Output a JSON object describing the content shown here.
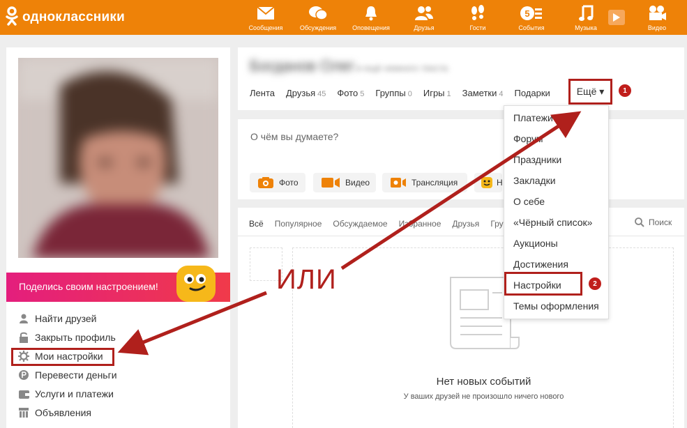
{
  "brand": {
    "name": "одноклассники"
  },
  "topnav": {
    "items": [
      {
        "label": "Сообщения",
        "icon": "envelope-icon"
      },
      {
        "label": "Обсуждения",
        "icon": "chat-bubbles-icon"
      },
      {
        "label": "Оповещения",
        "icon": "bell-icon"
      },
      {
        "label": "Друзья",
        "icon": "friends-icon"
      },
      {
        "label": "Гости",
        "icon": "footprints-icon"
      },
      {
        "label": "События",
        "icon": "events-icon",
        "badge": "5"
      },
      {
        "label": "Музыка",
        "icon": "music-note-icon"
      },
      {
        "label": "Видео",
        "icon": "video-camera-icon"
      }
    ]
  },
  "mood_banner": {
    "text": "Поделись своим настроением!"
  },
  "left_menu": {
    "items": [
      {
        "label": "Найти друзей",
        "icon": "person-icon"
      },
      {
        "label": "Закрыть профиль",
        "icon": "lock-icon"
      },
      {
        "label": "Мои настройки",
        "icon": "gear-icon"
      },
      {
        "label": "Перевести деньги",
        "icon": "coin-icon"
      },
      {
        "label": "Услуги и платежи",
        "icon": "wallet-icon"
      },
      {
        "label": "Объявления",
        "icon": "ads-icon"
      }
    ]
  },
  "profile": {
    "name": "Богданов Олег",
    "subtitle": "и ещё немного текста",
    "tabs": [
      {
        "label": "Лента",
        "count": ""
      },
      {
        "label": "Друзья",
        "count": "45"
      },
      {
        "label": "Фото",
        "count": "5"
      },
      {
        "label": "Группы",
        "count": "0"
      },
      {
        "label": "Игры",
        "count": "1"
      },
      {
        "label": "Заметки",
        "count": "4"
      },
      {
        "label": "Подарки",
        "count": ""
      }
    ],
    "more_label": "Ещё ▾"
  },
  "post": {
    "placeholder": "О чём вы думаете?",
    "buttons": [
      {
        "label": "Фото",
        "icon": "camera-icon"
      },
      {
        "label": "Видео",
        "icon": "video-icon"
      },
      {
        "label": "Трансляция",
        "icon": "broadcast-icon"
      },
      {
        "label": "Н",
        "icon": "mood-icon"
      }
    ]
  },
  "feed": {
    "tabs": [
      "Всё",
      "Популярное",
      "Обсуждаемое",
      "Избранное",
      "Друзья",
      "Гру"
    ],
    "search_label": "Поиск",
    "empty_title": "Нет новых событий",
    "empty_subtitle": "У ваших друзей не произошло ничего нового"
  },
  "dropdown": {
    "items": [
      "Платежи",
      "Форум",
      "Праздники",
      "Закладки",
      "О себе",
      "«Чёрный список»",
      "Аукционы",
      "Достижения",
      "Настройки",
      "Темы оформления"
    ]
  },
  "annotations": {
    "or_text": "ИЛИ",
    "step1": "1",
    "step2": "2",
    "color": "#b0201c"
  },
  "colors": {
    "brand_orange": "#ee8208",
    "mood_gradient_start": "#e41e7d",
    "mood_gradient_end": "#f03a4a",
    "button_orange": "#ee8208"
  }
}
